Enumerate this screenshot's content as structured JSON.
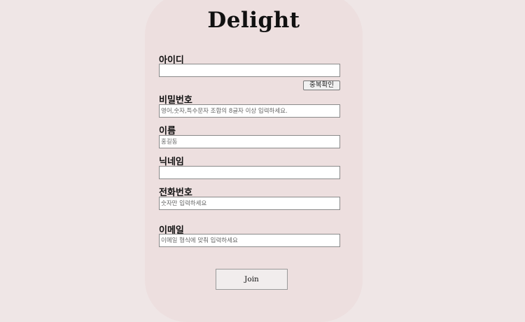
{
  "brand": {
    "title": "Delight"
  },
  "form": {
    "id": {
      "label": "아이디",
      "value": "",
      "placeholder": ""
    },
    "duplicate_check_label": "중복확인",
    "password": {
      "label": "비밀번호",
      "value": "",
      "placeholder": "영어,숫자,특수문자 조합의 8글자 이상 입력하세요."
    },
    "name": {
      "label": "이름",
      "value": "",
      "placeholder": "홍길동"
    },
    "nickname": {
      "label": "닉네임",
      "value": "",
      "placeholder": ""
    },
    "phone": {
      "label": "전화번호",
      "value": "",
      "placeholder": "숫자만 입력하세요"
    },
    "email": {
      "label": "이메일",
      "value": "",
      "placeholder": "이메일 형식에 맞춰 입력하세요"
    },
    "join_label": "Join"
  }
}
